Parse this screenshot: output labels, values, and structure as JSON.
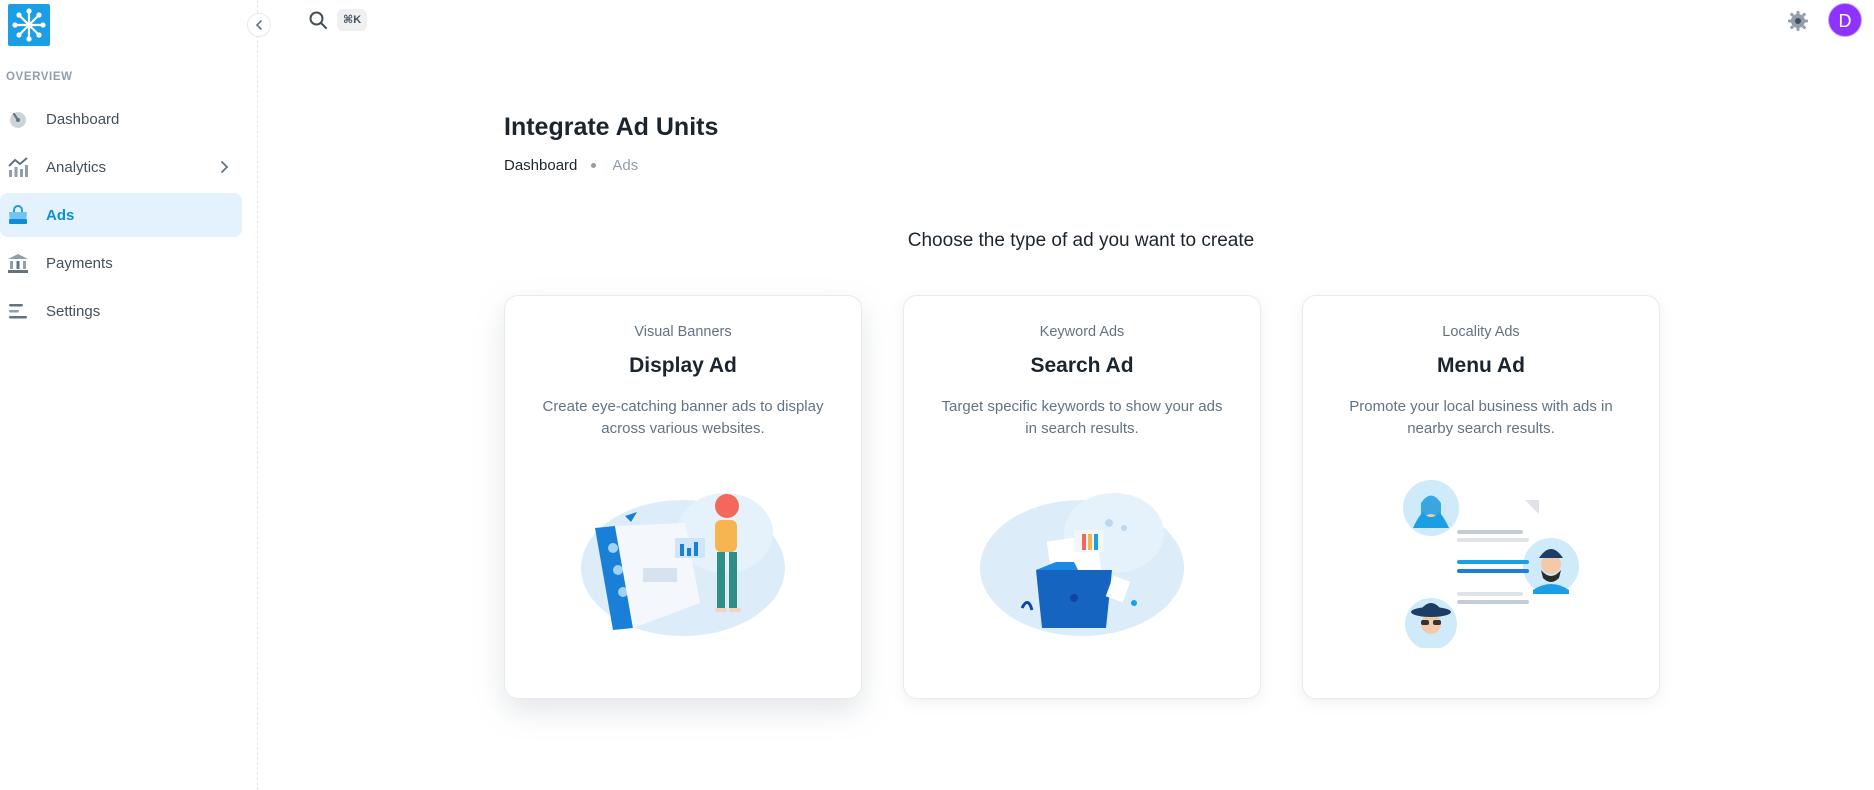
{
  "sidebar": {
    "section_label": "OVERVIEW",
    "items": [
      {
        "label": "Dashboard",
        "icon": "dashboard-gauge-icon"
      },
      {
        "label": "Analytics",
        "icon": "analytics-chart-icon"
      },
      {
        "label": "Ads",
        "icon": "ads-bag-icon"
      },
      {
        "label": "Payments",
        "icon": "payments-bank-icon"
      },
      {
        "label": "Settings",
        "icon": "settings-sliders-icon"
      }
    ],
    "active_item": "Ads"
  },
  "topbar": {
    "search_shortcut": "⌘K",
    "avatar_letter": "D"
  },
  "page": {
    "title": "Integrate Ad Units",
    "breadcrumb": [
      "Dashboard",
      "Ads"
    ],
    "subtitle": "Choose the type of ad you want to create"
  },
  "cards": [
    {
      "eyebrow": "Visual Banners",
      "title": "Display Ad",
      "description": "Create eye-catching banner ads to display across various websites."
    },
    {
      "eyebrow": "Keyword Ads",
      "title": "Search Ad",
      "description": "Target specific keywords to show your ads in search results."
    },
    {
      "eyebrow": "Locality Ads",
      "title": "Menu Ad",
      "description": "Promote your local business with ads in nearby search results."
    }
  ],
  "colors": {
    "brand": "#1a9fe6",
    "active_bg": "#e3f2fc",
    "active_text": "#0b8fd6",
    "avatar": "#8e33ff"
  }
}
